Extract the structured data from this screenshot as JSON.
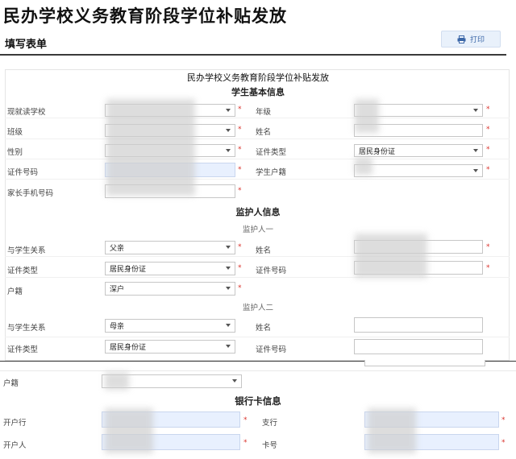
{
  "page": {
    "title": "民办学校义务教育阶段学位补贴发放",
    "section": "填写表单",
    "print_label": "打印"
  },
  "form": {
    "title": "民办学校义务教育阶段学位补贴发放",
    "student_heading": "学生基本信息",
    "guardian_heading": "监护人信息",
    "guardian1_heading": "监护人一",
    "guardian2_heading": "监护人二",
    "bank_heading": "银行卡信息",
    "required_mark": "*"
  },
  "student": {
    "school_label": "现就读学校",
    "school_value": "",
    "grade_label": "年级",
    "grade_value": "",
    "class_label": "班级",
    "class_value": "",
    "name_label": "姓名",
    "name_value": "",
    "gender_label": "性别",
    "gender_value": "",
    "id_type_label": "证件类型",
    "id_type_value": "居民身份证",
    "id_no_label": "证件号码",
    "id_no_value": "",
    "hukou_label": "学生户籍",
    "hukou_value": "",
    "phone_label": "家长手机号码",
    "phone_value": ""
  },
  "guardian1": {
    "relation_label": "与学生关系",
    "relation_value": "父亲",
    "name_label": "姓名",
    "name_value": "",
    "id_type_label": "证件类型",
    "id_type_value": "居民身份证",
    "id_no_label": "证件号码",
    "id_no_value": "",
    "hukou_label": "户籍",
    "hukou_value": "深户"
  },
  "guardian2": {
    "relation_label": "与学生关系",
    "relation_value": "母亲",
    "name_label": "姓名",
    "name_value": "",
    "id_type_label": "证件类型",
    "id_type_value": "居民身份证",
    "id_no_label": "证件号码",
    "id_no_value": "",
    "hukou_label": "户籍",
    "hukou_value": ""
  },
  "bank": {
    "bank_label": "开户行",
    "bank_value": "",
    "branch_label": "支行",
    "branch_value": "",
    "holder_label": "开户人",
    "holder_value": "",
    "card_label": "卡号",
    "card_value": ""
  },
  "colors": {
    "accent": "#3b67a8",
    "required": "#d9322c",
    "autofill": "#e8f0fe"
  }
}
